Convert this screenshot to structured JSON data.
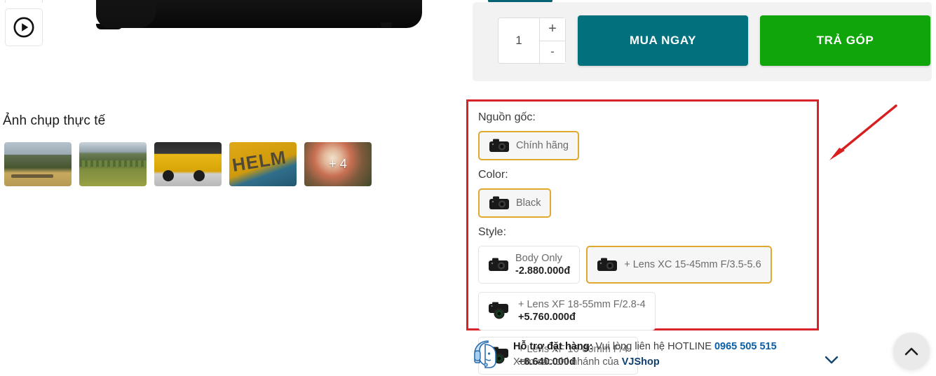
{
  "gallery": {
    "title": "Ảnh chụp thực tế",
    "play_button_icon": "play-circle-icon",
    "thumbnails": [
      {
        "alt": "mountain-landscape"
      },
      {
        "alt": "vineyard-mountains"
      },
      {
        "alt": "yellow-car"
      },
      {
        "alt": "helm-sign"
      },
      {
        "alt": "flowers",
        "more_label": "+ 4"
      }
    ]
  },
  "purchase": {
    "quantity": {
      "value": "1",
      "increase_label": "+",
      "decrease_label": "-"
    },
    "buy_now_label": "MUA NGAY",
    "installment_label": "TRẢ GÓP",
    "colors": {
      "buy_now": "#03707E",
      "installment": "#10A50A",
      "panel_bg": "#f2f2f2"
    }
  },
  "options": {
    "highlight_color": "#D8232A",
    "selected_border_color": "#E0A82E",
    "groups": [
      {
        "label": "Nguồn gốc:",
        "items": [
          {
            "name": "Chính hãng",
            "price": "",
            "selected": true,
            "icon": "camera-icon"
          }
        ]
      },
      {
        "label": "Color:",
        "items": [
          {
            "name": "Black",
            "price": "",
            "selected": true,
            "icon": "camera-icon"
          }
        ]
      },
      {
        "label": "Style:",
        "items": [
          {
            "name": "Body Only",
            "price": "-2.880.000đ",
            "selected": false,
            "icon": "camera-icon"
          },
          {
            "name": "+ Lens XC 15-45mm F/3.5-5.6",
            "price": "",
            "selected": true,
            "icon": "camera-icon"
          },
          {
            "name": "+ Lens XF 18-55mm F/2.8-4",
            "price": "+5.760.000đ",
            "selected": false,
            "icon": "camera-lens-icon"
          },
          {
            "name": "+ Lens XF 16-80mm F/4",
            "price": "+8.640.000đ",
            "selected": false,
            "icon": "camera-lens-icon"
          }
        ]
      }
    ]
  },
  "support": {
    "icon": "headset-support-icon",
    "line1_bold": "Hỗ trợ đặt hàng:",
    "line1_text": "Vui lòng liên hệ HOTLINE",
    "phone": "0965 505 515",
    "line2_text": "Xem các chi nhánh của",
    "line2_brand": "VJShop",
    "chevron_icon": "chevron-down-icon"
  },
  "annotation": {
    "arrow_color": "#D81E1E",
    "arrow_icon": "red-arrow-pointing-left-down"
  },
  "scroll_top": {
    "icon": "chevron-up-icon"
  }
}
